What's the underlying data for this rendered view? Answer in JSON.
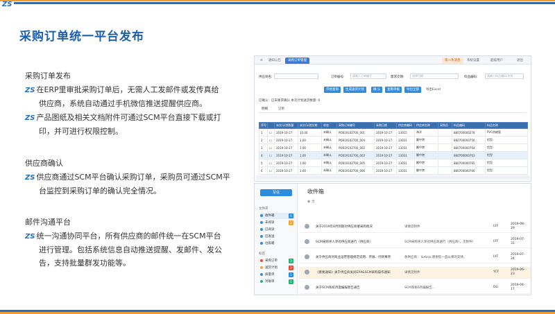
{
  "slide": {
    "logo": "ZS",
    "title": "采购订单统一平台发布",
    "sections": [
      {
        "heading": "采购订单发布",
        "bullets": [
          [
            "在ERP里审批采购订单后，无需人工发邮件或发传真给",
            "供应商，系统自动通过手机微信推送提醒供应商。"
          ],
          [
            "产品图纸及相关文档附件可通过SCM平台直接下载或打",
            "印，并可进行权限控制。"
          ]
        ]
      },
      {
        "heading": "供应商确认",
        "bullets": [
          [
            "供应商通过SCM平台确认采购订单，采购员可通过SCM平",
            "台监控到采购订单的确认完全情况。"
          ]
        ]
      },
      {
        "heading": "邮件沟通平台",
        "bullets": [
          [
            "统一沟通协同平台，所有供应商的邮件统一在SCM平台",
            "进行管理。包括系统信息自动推送提醒、发邮件、发公",
            "告，支持批量群发功能等。"
          ]
        ]
      }
    ]
  },
  "orders_screen": {
    "tabs": [
      "通知公告",
      "采购订单管理",
      "第一条消息",
      "系统设置",
      "超级用户",
      "退出"
    ],
    "filters": [
      {
        "label": "供应商名:",
        "placeholder": ""
      },
      {
        "label": "订单编号:",
        "placeholder": "请输入订单编号"
      },
      {
        "label": "需求交期:",
        "placeholder": "选择日期"
      },
      {
        "label": "料品编码:",
        "placeholder": "请输入料品编码/名称"
      }
    ],
    "buttons": [
      "开始查询",
      "生成送货计划",
      "确 认",
      "查看单据",
      "导出全部",
      "导出Excel"
    ],
    "info": "已确认：已未要求确认 本次计划送货数量: 0",
    "subtabs": [
      "明细",
      "订单"
    ],
    "columns": [
      "序号",
      "",
      "未交/计划数量",
      "未交/计划交期",
      "状态",
      "采购订单编号",
      "采购日期",
      "供应商编码",
      "供应商名称",
      "采购员",
      "料品编码",
      "料品名称"
    ],
    "rows": [
      [
        "1",
        "",
        "2019-10-27",
        "10.00",
        "未确认",
        "PO819102700_001",
        "2019-10-27",
        "13015",
        "海洋",
        "",
        "880700000278",
        "PVC热缩管"
      ],
      [
        "2",
        "",
        "2019-10-27",
        "1.00",
        "未确认",
        "PO819102700_004",
        "2019-10-27",
        "13031",
        "翻中港",
        "",
        "880700000756",
        "铝型"
      ],
      [
        "3",
        "",
        "2019-10-27",
        "1.00",
        "未确认",
        "PO819102700_002",
        "2019-10-27",
        "13031",
        "翻中港",
        "",
        "880700000764",
        "铝型"
      ],
      [
        "4",
        "",
        "2019-10-27",
        "1.00",
        "未确认",
        "PO819102700_003",
        "2019-10-27",
        "13031",
        "翻中港",
        "",
        "880700000763",
        "铝型"
      ],
      [
        "5",
        "",
        "2019-10-27",
        "1.00",
        "未确认",
        "PO819102700_005",
        "2019-10-27",
        "13031",
        "翻中港",
        "",
        "880700000765",
        "铝型"
      ],
      [
        "6",
        "",
        "2019-10-27",
        "1.00",
        "未确认",
        "PO819102700_006",
        "2019-10-27",
        "13031",
        "翻中港",
        "",
        "880700000766",
        "铝型"
      ]
    ]
  },
  "mail_screen": {
    "write": "写信",
    "mailbox_label": "文件夹",
    "folders": [
      {
        "label": "收件箱",
        "count": "6"
      },
      {
        "label": "未阅读",
        "count": "2"
      },
      {
        "label": "已阅读",
        "count": ""
      },
      {
        "label": "已发送",
        "count": ""
      },
      {
        "label": "垃圾箱",
        "count": ""
      }
    ],
    "tags_label": "标签",
    "tags": [
      {
        "label": "采购订单",
        "count": "3"
      },
      {
        "label": "送货计划",
        "count": "2"
      },
      {
        "label": "质量单",
        "count": "1"
      },
      {
        "label": "对账单",
        "count": "1"
      }
    ],
    "heading": "收件箱",
    "toolbar": "全",
    "messages": [
      {
        "subject": "关于2019年8月到期对供应商催采购情况",
        "preview": "详情见附件",
        "from": "LYF",
        "date": "2019-08-29"
      },
      {
        "subject": "SCM采购寻人单对供应商进行（供应商）",
        "preview": "SCM采购寻人单对供应商进行（供应商），见附件！",
        "from": "LYF",
        "date": "2019-07-31"
      },
      {
        "subject": "关于供应商对商业运营管理规范说明、开展、付款事项",
        "preview": "各供应商：  &nbsp;感谢您一直以来的支持。",
        "from": "LYF",
        "date": "2019-07-24"
      },
      {
        "subject": "《重要通知》关于供应商关闭ERP&SCM采购操作通知",
        "preview": "详情见附件",
        "from": "YCF",
        "date": "2019-06-23"
      },
      {
        "subject": "关于SCM系统月度编报暂告通告",
        "preview": "SCM系统6月编报告...",
        "from": "DG",
        "date": "2019-04-17"
      }
    ]
  }
}
